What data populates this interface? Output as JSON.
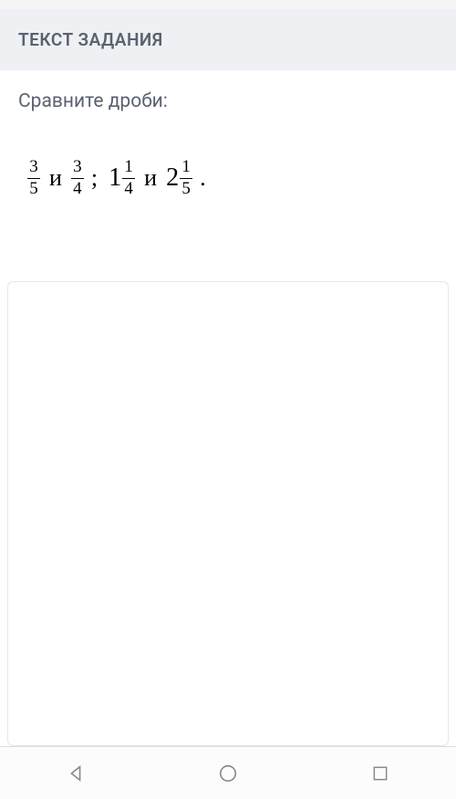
{
  "section_title": "ТЕКСТ ЗАДАНИЯ",
  "prompt": "Сравните дроби:",
  "math": {
    "pairs": [
      {
        "left": {
          "whole": "",
          "num": "3",
          "den": "5"
        },
        "conj": "и",
        "right": {
          "whole": "",
          "num": "3",
          "den": "4"
        }
      },
      {
        "left": {
          "whole": "1",
          "num": "1",
          "den": "4"
        },
        "conj": "и",
        "right": {
          "whole": "2",
          "num": "1",
          "den": "5"
        }
      }
    ],
    "separator": ";",
    "terminator": "."
  }
}
